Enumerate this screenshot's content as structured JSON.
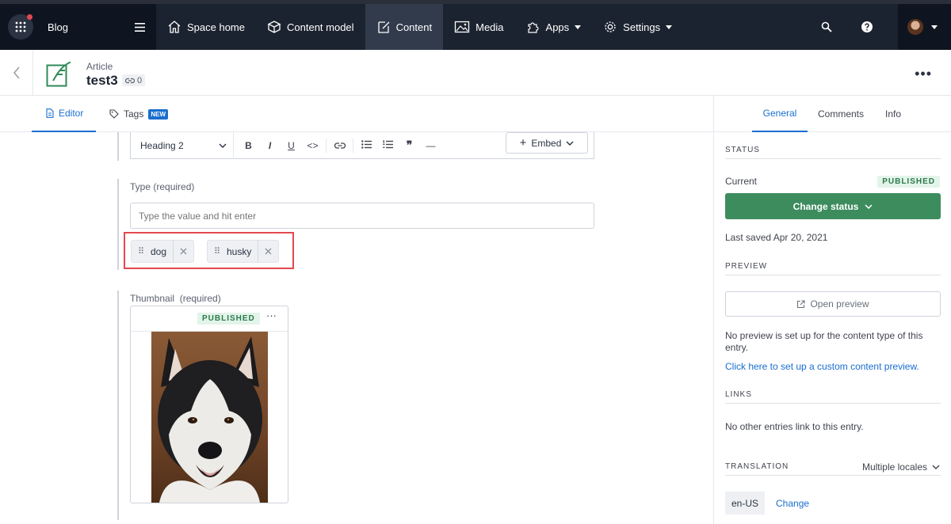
{
  "topnav": {
    "space_name": "Blog",
    "items": [
      {
        "label": "Space home",
        "icon": "home-icon"
      },
      {
        "label": "Content model",
        "icon": "content-model-icon"
      },
      {
        "label": "Content",
        "icon": "content-icon",
        "active": true
      },
      {
        "label": "Media",
        "icon": "media-icon"
      },
      {
        "label": "Apps",
        "icon": "apps-icon"
      },
      {
        "label": "Settings",
        "icon": "settings-icon"
      }
    ]
  },
  "entry": {
    "content_type": "Article",
    "title": "test3",
    "references_count": "0"
  },
  "editor_tabs": {
    "editor": "Editor",
    "tags": "Tags",
    "tags_badge": "NEW"
  },
  "richtext_toolbar": {
    "heading": "Heading 2",
    "bold": "B",
    "italic": "I",
    "underline": "U",
    "code": "<>",
    "quote": "❞",
    "hr": "—",
    "embed": "Embed"
  },
  "type_field": {
    "label": "Type (required)",
    "placeholder": "Type the value and hit enter",
    "tags": [
      "dog",
      "husky"
    ]
  },
  "thumbnail_field": {
    "label": "Thumbnail  (required)",
    "status": "PUBLISHED",
    "more": "···"
  },
  "sidebar": {
    "tabs": [
      "General",
      "Comments",
      "Info"
    ],
    "status_heading": "STATUS",
    "current_label": "Current",
    "current_status": "PUBLISHED",
    "change_status": "Change status",
    "last_saved": "Last saved Apr 20, 2021",
    "preview_heading": "PREVIEW",
    "open_preview": "Open preview",
    "preview_note": "No preview is set up for the content type of this entry.",
    "preview_link": "Click here to set up a custom content preview.",
    "links_heading": "LINKS",
    "links_note": "No other entries link to this entry.",
    "translation_heading": "TRANSLATION",
    "locale_mode": "Multiple locales",
    "locale": "en-US",
    "change_locale": "Change"
  },
  "colors": {
    "nav_bg": "#1c2330",
    "accent": "#1a6ecf",
    "published_green": "#3d8c5e",
    "highlight_red": "#e34850"
  }
}
